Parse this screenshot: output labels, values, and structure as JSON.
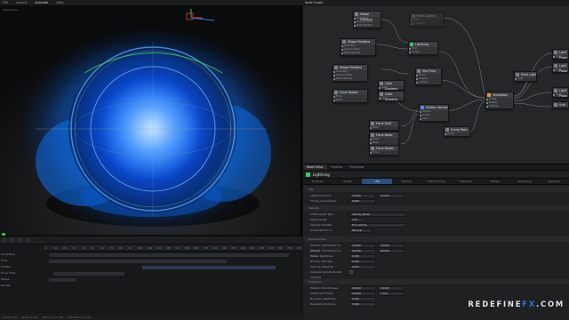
{
  "topbar": {
    "items": [
      "File",
      "Layout",
      "Animate",
      "Help"
    ]
  },
  "viewport": {
    "label": "Perspective",
    "accent": "#1f7cff"
  },
  "timeline": {
    "ruler": [
      "0",
      "10",
      "20",
      "30",
      "40",
      "50",
      "60",
      "70",
      "80",
      "90",
      "100",
      "110",
      "120",
      "130",
      "140",
      "150",
      "160",
      "170",
      "180",
      "190",
      "200",
      "210",
      "220",
      "230",
      "240",
      "250",
      "260",
      "270"
    ],
    "tracks": [
      {
        "label": "Simulation"
      },
      {
        "label": "Time"
      },
      {
        "label": "Emitter"
      },
      {
        "label": "Force Field"
      },
      {
        "label": "Shape"
      },
      {
        "label": "Render"
      }
    ],
    "footer": [
      "Frame 120",
      "Speed 1.00x",
      "Memory 2.1 GB",
      "Simulation Cache"
    ]
  },
  "node_graph": {
    "title": "Node Graph",
    "nodes": [
      {
        "title": "Shape Primitive",
        "ports": [
          "Geometry",
          "Volume Fields",
          "Mesh Dataset"
        ]
      },
      {
        "title": "Mesh Loader",
        "ports": [
          "Mesh",
          "Transform"
        ]
      },
      {
        "title": "Shape Primitive",
        "ports": [
          "Geometry",
          "Volume Fields",
          "Mesh Dataset"
        ]
      },
      {
        "title": "Lightning",
        "ports": [
          "Fluid",
          "Output"
        ]
      },
      {
        "title": "Shape Primitive",
        "ports": [
          "Geometry",
          "Volume Fields",
          "Mesh Dataset"
        ]
      },
      {
        "title": "Color Gradient",
        "ports": [
          "Color"
        ]
      },
      {
        "title": "Color Gradient",
        "ports": [
          "Color"
        ]
      },
      {
        "title": "Force Twister",
        "ports": [
          "Force",
          "Mask"
        ]
      },
      {
        "title": "Force Field",
        "ports": [
          "Force"
        ]
      },
      {
        "title": "Force Noise",
        "ports": [
          "Force",
          "Mask"
        ]
      },
      {
        "title": "Force Radial",
        "ports": [
          "Force"
        ]
      },
      {
        "title": "Sim Fluid",
        "ports": [
          "Force",
          "Volume",
          "Collision"
        ]
      },
      {
        "title": "Scene Point",
        "ports": [
          "Points"
        ]
      },
      {
        "title": "Emitter Volume",
        "ports": [
          "Volume",
          "Forces",
          "Color"
        ]
      },
      {
        "title": "Simulation",
        "ports": [
          "Forces",
          "Emitter",
          "Colliders"
        ]
      },
      {
        "title": "Point Light",
        "ports": [
          "Light"
        ]
      },
      {
        "title": "Light Probe",
        "ports": [
          "Light"
        ]
      },
      {
        "title": "Light Probe",
        "ports": [
          "Light"
        ]
      },
      {
        "title": "Light Probe",
        "ports": [
          "Light"
        ]
      },
      {
        "title": "Grid",
        "ports": []
      }
    ]
  },
  "properties": {
    "tabs": [
      "Node Editor",
      "Timeline",
      "Properties"
    ],
    "title": "Lightning",
    "categories": [
      "Emission",
      "Shape",
      "Life",
      "Velocity",
      "Active Forces",
      "Collisions",
      "Shader",
      "Rendering",
      "Operator"
    ],
    "active_category": "Life",
    "sections": [
      {
        "label": "Life",
        "rows": [
          {
            "label": "Lifetime frames",
            "value": "10.000",
            "value2": "12.000"
          },
          {
            "label": "Timing randomness",
            "value": "0.000"
          }
        ]
      },
      {
        "label": "Velocity",
        "rows": [
          {
            "label": "Initial speed Type",
            "value": "Velocity Noise"
          },
          {
            "label": "Speed scale",
            "value": "0.50"
          },
          {
            "label": "Velocity transfer",
            "value": "Full velocity"
          },
          {
            "label": "Incidental Force",
            "value": "Minimal"
          }
        ]
      },
      {
        "label": "Active forces",
        "rows": [
          {
            "label": "Volume contribution to physics",
            "value": "15.000",
            "value2": "75.000"
          },
          {
            "label": "Volume contribution to force",
            "value": "20.000",
            "value2": "60.000"
          },
          {
            "label": "Forces Sightlines",
            "value": "0.000"
          },
          {
            "label": "Gravity intensity",
            "value": "0.500"
          },
          {
            "label": "Velocity damping",
            "value": "0.001"
          },
          {
            "label": "Detected gravity/Scalar induced",
            "value": ""
          }
        ]
      },
      {
        "label": "Collisions",
        "rows": [
          {
            "label": "Position Smoothness",
            "value": "20.000",
            "value2": "10.000"
          },
          {
            "label": "Positional Friction",
            "value": "20.000",
            "value2": "7.500"
          },
          {
            "label": "Bounces restitution",
            "value": "0.000"
          },
          {
            "label": "Repulsion distance",
            "value": "0.000"
          }
        ]
      }
    ]
  },
  "watermark": {
    "text": "REDEFINE",
    "accent_text": "FX",
    "suffix": ".COM"
  }
}
